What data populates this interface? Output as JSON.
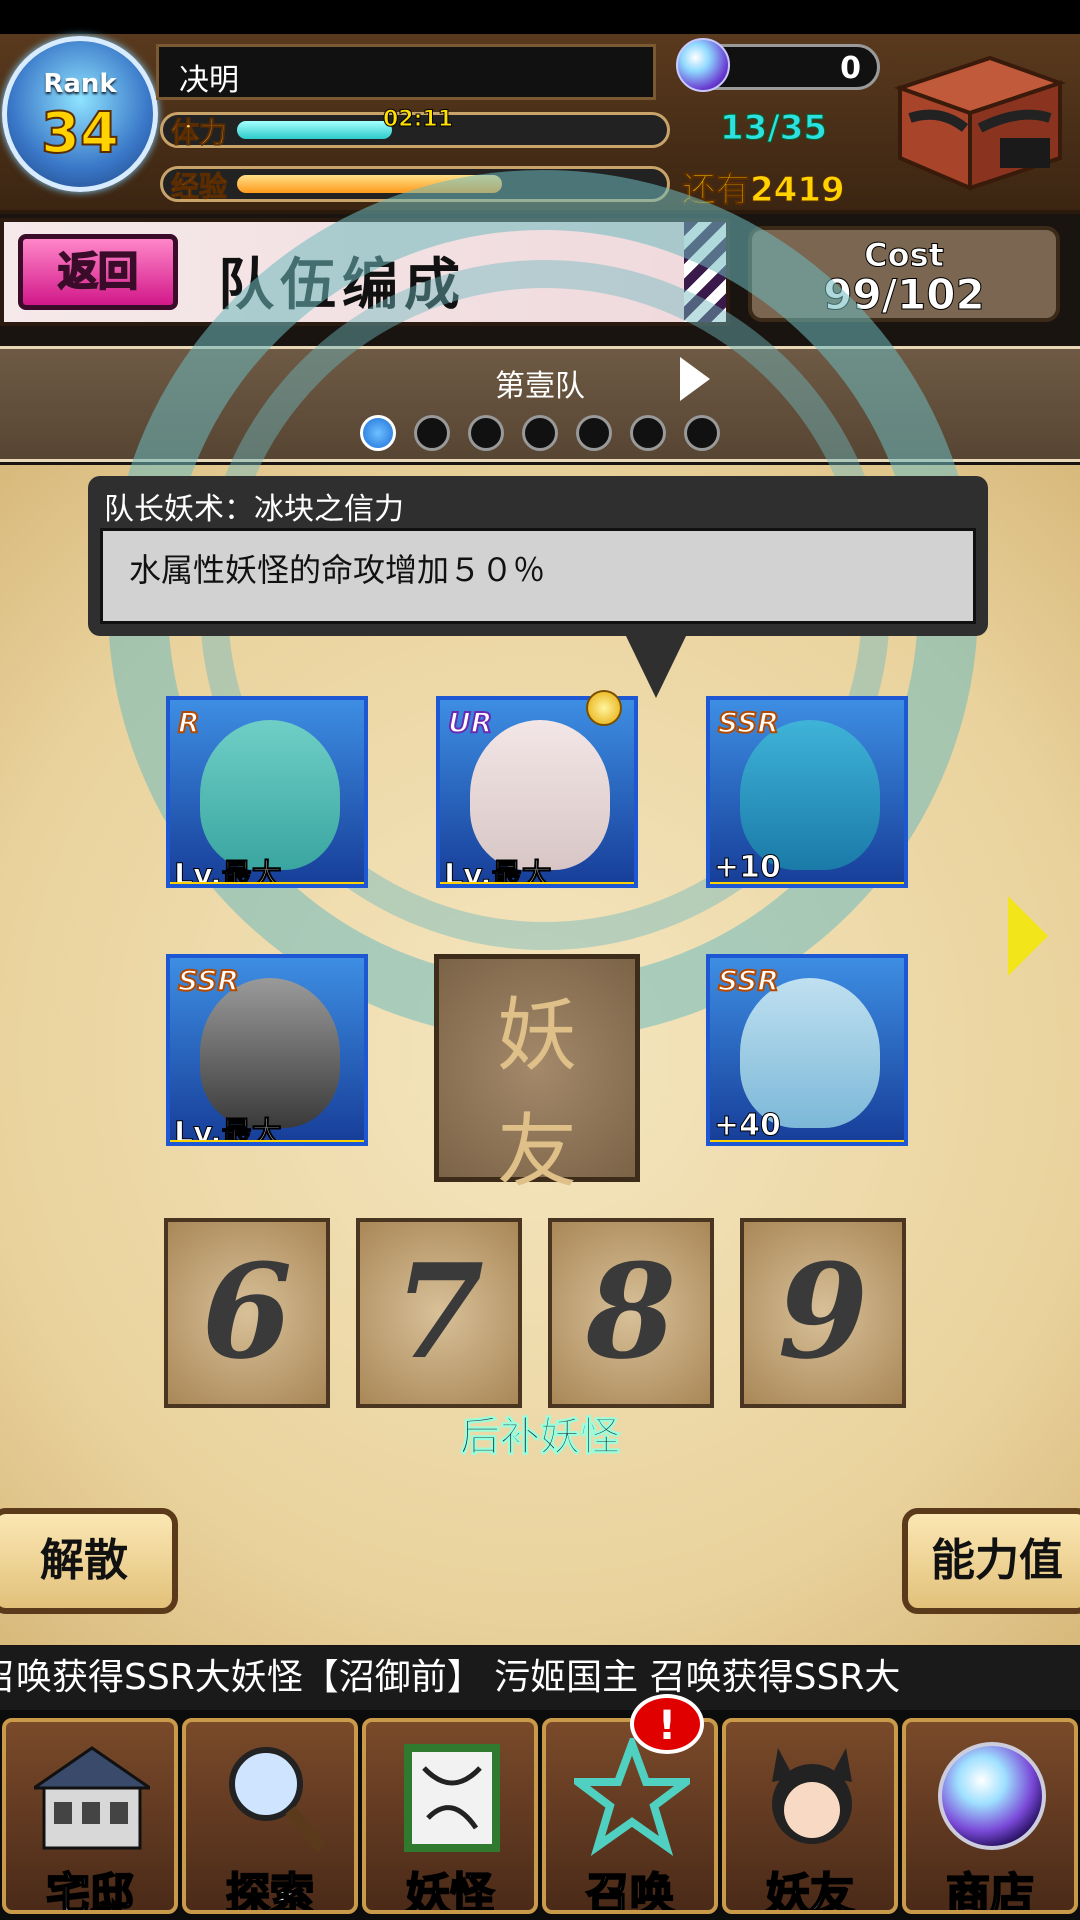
{
  "header": {
    "rank_label": "Rank",
    "rank_value": "34",
    "player_name": "决明",
    "stamina_label": "体力",
    "stamina_timer": "02:11",
    "stamina_count": "13/35",
    "stamina_fraction": 0.37,
    "exp_label": "经验",
    "exp_remaining": "还有2419",
    "exp_fraction": 0.63,
    "orb_count": "0"
  },
  "title_bar": {
    "back_label": "返回",
    "title": "队伍编成",
    "cost_label": "Cost",
    "cost_value": "99/102"
  },
  "team_selector": {
    "team_name": "第壹队",
    "page_count": 7,
    "active_page": 1
  },
  "leader_skill": {
    "title": "队长妖术：冰块之信力",
    "description": "水属性妖怪的命攻增加５０％"
  },
  "team": {
    "cards": [
      {
        "rarity": "R",
        "level": "Lv.最大"
      },
      {
        "rarity": "UR",
        "level": "Lv.最大"
      },
      {
        "rarity": "SSR",
        "level": "+10"
      },
      {
        "rarity": "SSR",
        "level": "Lv.最大"
      },
      {
        "rarity": "SSR",
        "level": "+40"
      }
    ],
    "friend_slot_label_1": "妖",
    "friend_slot_label_2": "友",
    "reserve_slots": [
      "6",
      "7",
      "8",
      "9"
    ],
    "reserve_label": "后补妖怪"
  },
  "actions": {
    "disband": "解散",
    "stats": "能力值"
  },
  "ticker": "召唤获得SSR大妖怪【沼御前】      污姬国主 召唤获得SSR大",
  "nav": {
    "items": [
      "宅邸",
      "探索",
      "妖怪",
      "召唤",
      "妖友",
      "商店"
    ],
    "badge": "!"
  },
  "colors": {
    "accent_pink": "#d2188a",
    "stamina_cyan": "#2cc9c9",
    "exp_orange": "#ff9a1a",
    "gold": "#ffd200"
  }
}
